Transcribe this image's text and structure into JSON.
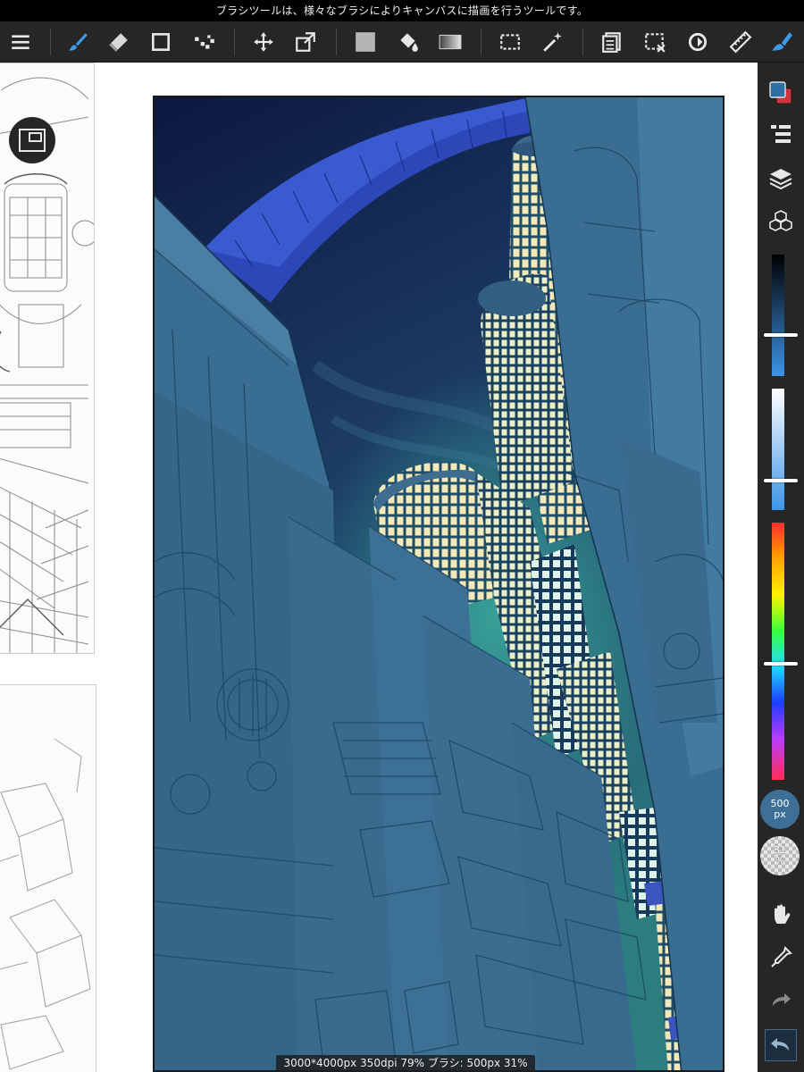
{
  "status_bar": {
    "text": "ブラシツールは、様々なブラシによりキャンバスに描画を行うツールです。"
  },
  "toolbar": {
    "tools": [
      {
        "name": "menu-icon",
        "active": false
      },
      {
        "name": "brush-icon",
        "active": true
      },
      {
        "name": "eraser-icon",
        "active": false
      },
      {
        "name": "shape-icon",
        "active": false
      },
      {
        "name": "dot-icon",
        "active": false
      },
      {
        "name": "move-icon",
        "active": false
      },
      {
        "name": "transform-icon",
        "active": false
      },
      {
        "name": "fill-color-icon",
        "active": false
      },
      {
        "name": "bucket-icon",
        "active": false
      },
      {
        "name": "gradient-icon",
        "active": false
      },
      {
        "name": "select-icon",
        "active": false
      },
      {
        "name": "magic-wand-icon",
        "active": false
      },
      {
        "name": "copy-icon",
        "active": false
      },
      {
        "name": "deselect-icon",
        "active": false
      },
      {
        "name": "rotate-icon",
        "active": false
      },
      {
        "name": "ruler-icon",
        "active": false
      },
      {
        "name": "brush-settings-icon",
        "active": true
      }
    ]
  },
  "side_panel": {
    "colors": {
      "primary": "#2e6fa6",
      "secondary": "#d0343a",
      "accent": "#4aa3f0"
    },
    "sliders": {
      "brightness_level": 0.66,
      "saturation_level": 0.76,
      "hue_level": 0.55
    },
    "brush_size": {
      "value": "500",
      "unit": "px"
    },
    "opacity": {
      "value": "31",
      "unit": "%"
    }
  },
  "info_bar": {
    "text": "3000*4000px 350dpi 79% ブラシ: 500px 31%"
  }
}
